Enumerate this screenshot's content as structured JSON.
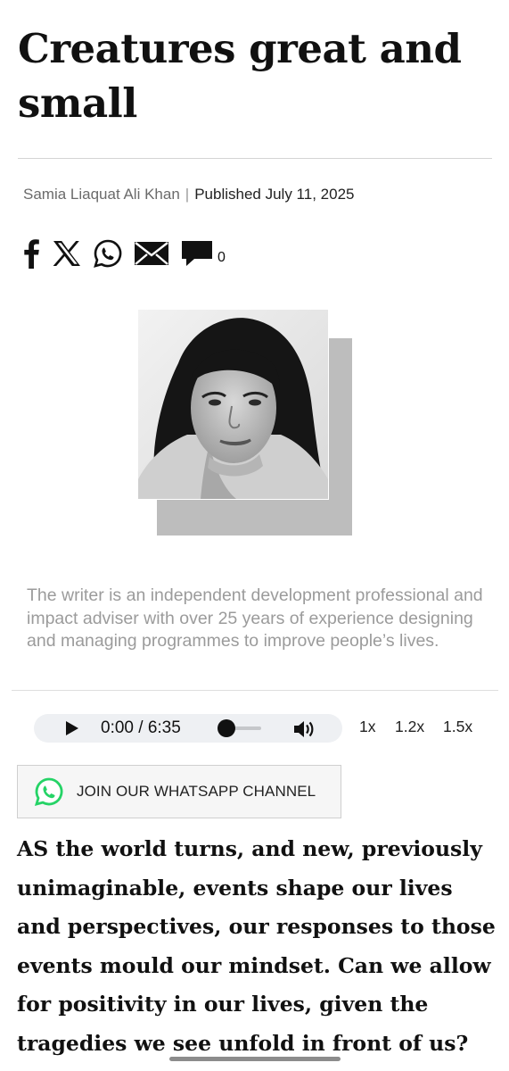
{
  "article": {
    "title": "Creatures great and small",
    "author": "Samia Liaquat Ali Khan",
    "separator": "|",
    "published": "Published July 11, 2025"
  },
  "share": {
    "icons": [
      "facebook-icon",
      "x-icon",
      "whatsapp-icon",
      "email-icon",
      "comment-icon"
    ],
    "comment_count": "0"
  },
  "writer": {
    "bio": "The writer is an independent development professional and impact adviser with over 25 years of experience designing and managing programmes to improve people’s lives."
  },
  "audio": {
    "time": "0:00 / 6:35",
    "progress": 0,
    "speeds": [
      "1x",
      "1.2x",
      "1.5x"
    ]
  },
  "whatsapp_channel": {
    "label": "JOIN OUR WHATSAPP CHANNEL",
    "accent": "#25d366"
  },
  "body": {
    "lead": "AS the world turns, and new, previously unimaginable, events shape our lives and perspectives, our responses to those events mould our mindset. Can we allow for positivity in our lives, given the tragedies we see unfold in front of us?"
  }
}
